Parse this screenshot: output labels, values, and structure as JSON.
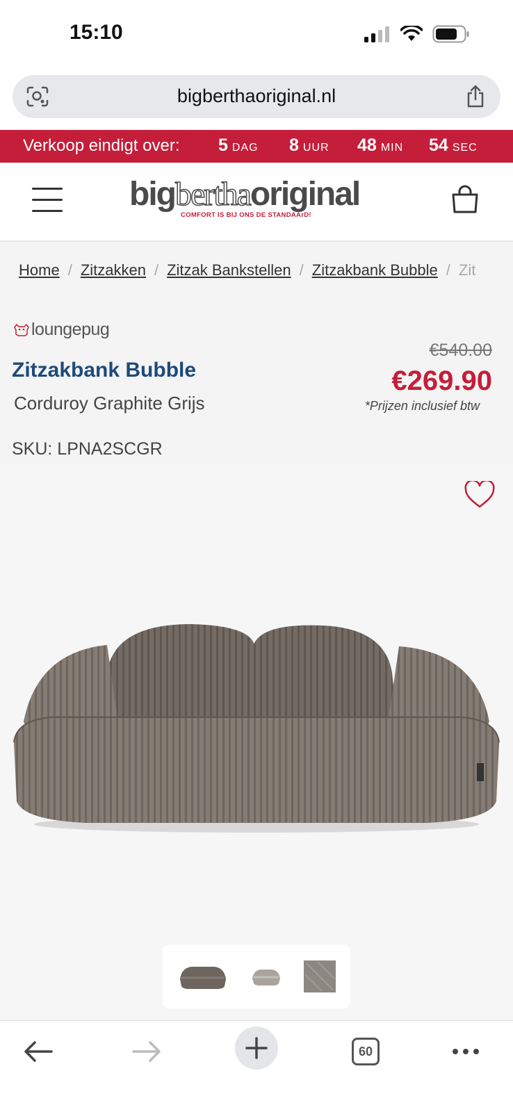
{
  "status_bar": {
    "time": "15:10"
  },
  "browser": {
    "url": "bigberthaoriginal.nl",
    "tab_count": "60"
  },
  "countdown": {
    "label": "Verkoop eindigt over:",
    "units": [
      {
        "value": "5",
        "unit": "DAG"
      },
      {
        "value": "8",
        "unit": "UUR"
      },
      {
        "value": "48",
        "unit": "MIN"
      },
      {
        "value": "54",
        "unit": "SEC"
      }
    ]
  },
  "header": {
    "logo_left": "big",
    "logo_mid": "bertha",
    "logo_right": "original",
    "logo_tagline": "COMFORT IS BIJ ONS DE STANDAArD!"
  },
  "breadcrumb": {
    "items": [
      "Home",
      "Zitzakken",
      "Zitzak Bankstellen",
      "Zitzakbank Bubble"
    ],
    "current": "Zit"
  },
  "product": {
    "brand": "loungepug",
    "title": "Zitzakbank Bubble",
    "variant": "Corduroy Graphite Grijs",
    "old_price": "€540.00",
    "price": "€269.90",
    "vat_note": "*Prijzen inclusief btw",
    "sku": "SKU: LPNA2SCGR"
  },
  "colors": {
    "accent_red": "#c41e3a",
    "title_blue": "#1e4a7a"
  }
}
